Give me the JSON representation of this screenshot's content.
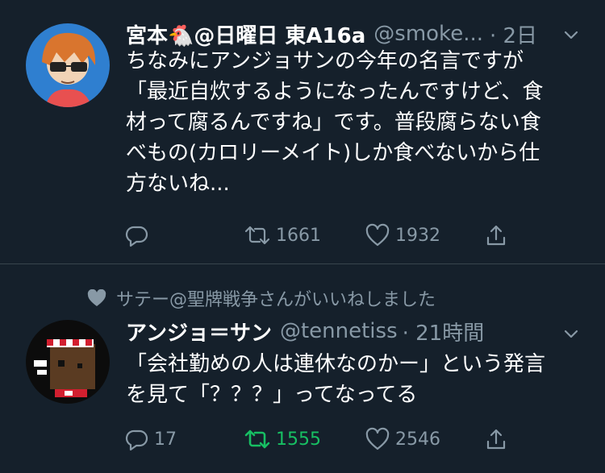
{
  "tweet1": {
    "display_name": "宮本🐔@日曜日 東A16a",
    "handle": "@smoke...",
    "time": "· 2日",
    "text_lines": [
      "ちなみにアンジョサンの今年の名言ですが",
      "「最近自炊するようになったんですけど、食",
      "材って腐るんですね」です。普段腐らない食",
      "べもの(カロリーメイト)しか食べないから仕",
      "方ないね..."
    ],
    "reply_count": "",
    "retweet_count": "1661",
    "like_count": "1932"
  },
  "social_context": {
    "text": "サテー@聖牌戦争さんがいいねしました",
    "icon": "heart-icon"
  },
  "tweet2": {
    "display_name": "アンジョ＝サン",
    "handle": "@tennetiss",
    "time": "· 21時間",
    "text_lines": [
      "「会社勤めの人は連休なのかー」という発言",
      "を見て「？？？」ってなってる"
    ],
    "reply_count": "17",
    "retweet_count": "1555",
    "like_count": "2546",
    "retweeted": true
  },
  "colors": {
    "background": "#15202b",
    "secondary_text": "#8899a6",
    "divider": "#38444d",
    "retweet_active": "#17bf63"
  },
  "icons": [
    "reply-icon",
    "retweet-icon",
    "like-icon",
    "share-icon",
    "chevron-down-icon"
  ]
}
